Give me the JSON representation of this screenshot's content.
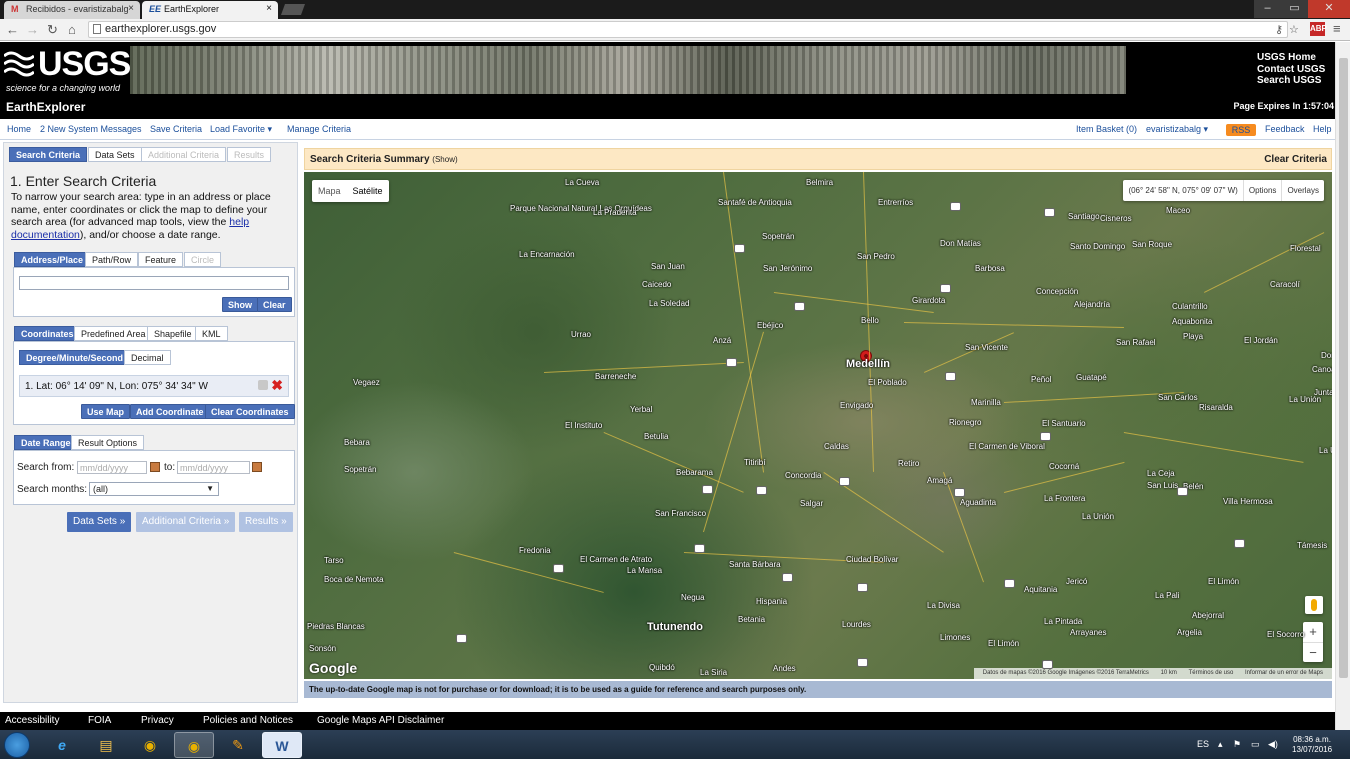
{
  "browser": {
    "tabs": [
      {
        "favicon": "M",
        "title": "Recibidos - evaristizabalg"
      },
      {
        "favicon": "EE",
        "title": "EarthExplorer"
      }
    ],
    "url": "earthexplorer.usgs.gov",
    "window_controls": [
      "–",
      "▭",
      "✕"
    ]
  },
  "header": {
    "logo_word": "USGS",
    "logo_tagline": "science for a changing world",
    "links": [
      "USGS Home",
      "Contact USGS",
      "Search USGS"
    ],
    "app_title": "EarthExplorer",
    "page_expires": "Page Expires In 1:57:04"
  },
  "menu": {
    "left": [
      "Home",
      "2 New System Messages",
      "Save Criteria",
      "Load Favorite ▾",
      "Manage Criteria"
    ],
    "right": [
      "Item Basket (0)",
      "evaristizabalg ▾",
      "RSS",
      "Feedback",
      "Help"
    ]
  },
  "left_panel": {
    "tabs": [
      "Search Criteria",
      "Data Sets",
      "Additional Criteria",
      "Results"
    ],
    "heading": "1. Enter Search Criteria",
    "intro_before": "To narrow your search area: type in an address or place name, enter coordinates or click the map to define your search area (for advanced map tools, view the ",
    "intro_link": "help documentation",
    "intro_after": "), and/or choose a date range.",
    "address_tabs": [
      "Address/Place",
      "Path/Row",
      "Feature",
      "Circle"
    ],
    "address_value": "",
    "show_btn": "Show",
    "clear_btn": "Clear",
    "coord_tabs": [
      "Coordinates",
      "Predefined Area",
      "Shapefile",
      "KML"
    ],
    "format_tabs": [
      "Degree/Minute/Second",
      "Decimal"
    ],
    "coordinate": "1.  Lat: 06° 14' 09\" N, Lon: 075° 34' 34\" W",
    "use_map": "Use Map",
    "add_coord": "Add Coordinate",
    "clear_coords": "Clear Coordinates",
    "date_tabs": [
      "Date Range",
      "Result Options"
    ],
    "search_from": "Search from:",
    "date_placeholder": "mm/dd/yyyy",
    "to": "to:",
    "search_months": "Search months:",
    "months_value": "(all)",
    "nav_buttons": [
      "Data Sets »",
      "Additional Criteria »",
      "Results »"
    ]
  },
  "map": {
    "summary_title": "Search Criteria Summary",
    "summary_show": "(Show)",
    "clear_criteria": "Clear Criteria",
    "type_buttons": [
      "Mapa",
      "Satélite"
    ],
    "coord_readout": "(06° 24' 58\" N, 075° 09' 07\" W)",
    "options": "Options",
    "overlays": "Overlays",
    "zoom_in": "+",
    "zoom_out": "−",
    "google": "Google",
    "attribution": [
      "Datos de mapas ©2016 Google Imágenes ©2016 TerraMetrics",
      "10 km",
      "Términos de uso",
      "Informar de un error de Maps"
    ],
    "disclaimer": "The up-to-date Google map is not for purchase or for download; it is to be used as a guide for reference and search purposes only.",
    "places": [
      "La Cueva",
      "Belmira",
      "Parque Nacional Natural Las Orquídeas",
      "La Praderita",
      "Santafé de Antioquia",
      "Entrerríos",
      "Santiago",
      "Cisneros",
      "Maceo",
      "La Encarnación",
      "Sopetrán",
      "Don Matías",
      "Santo Domingo",
      "San Roque",
      "Florestal",
      "San Juan",
      "San Jerónimo",
      "San Pedro",
      "Barbosa",
      "Caicedo",
      "Girardota",
      "Concepción",
      "Caracolí",
      "La Soledad",
      "Alejandría",
      "Culantrillo",
      "Aquabonita",
      "Urrao",
      "Ebéjico",
      "Bello",
      "Playa",
      "San Rafael",
      "El Jordán",
      "Anzá",
      "San Vicente",
      "Barreneche",
      "Medellín",
      "El Poblado",
      "Peñol",
      "Guatapé",
      "Vegaez",
      "Yerbal",
      "Envigado",
      "Marinilla",
      "San Carlos",
      "Risaralda",
      "La Unión",
      "El Instituto",
      "Rionegro",
      "El Santuario",
      "Betulia",
      "Caldas",
      "El Carmen de Viboral",
      "Bebara",
      "Titiribí",
      "Retiro",
      "Cocorná",
      "Sopetrán",
      "Bebarama",
      "Concordia",
      "Amagá",
      "La Ceja",
      "San Luis",
      "Belén",
      "La Frontera",
      "Villa Hermosa",
      "Aguadinta",
      "La Unión",
      "San Francisco",
      "Salgar",
      "Fredonia",
      "El Carmen de Atrato",
      "La Mansa",
      "Ciudad Bolívar",
      "Santa Bárbara",
      "Tarso",
      "Boca de Nemota",
      "Negua",
      "Hispania",
      "Jericó",
      "El Limón",
      "Aquitania",
      "La Divisa",
      "Abejorral",
      "Piedras Blancas",
      "Tutunendo",
      "Betania",
      "Lourdes",
      "La Pintada",
      "Arrayanes",
      "Argelia",
      "El Socorro",
      "Limones",
      "El Limón",
      "Sonsón",
      "Quibdó",
      "La Siria",
      "Andes",
      "Támesis",
      "Doradal",
      "Canoas",
      "Juntas",
      "La Unión",
      "La Pali"
    ]
  },
  "footer": [
    "Accessibility",
    "FOIA",
    "Privacy",
    "Policies and Notices",
    "Google Maps API Disclaimer"
  ],
  "taskbar": {
    "lang": "ES",
    "time": "08:36 a.m.",
    "date": "13/07/2016"
  },
  "colors": {
    "accent_blue": "#4a6fb8",
    "summary_bg": "#fde8c4",
    "disclaimer_bg": "#a8b9d3"
  }
}
